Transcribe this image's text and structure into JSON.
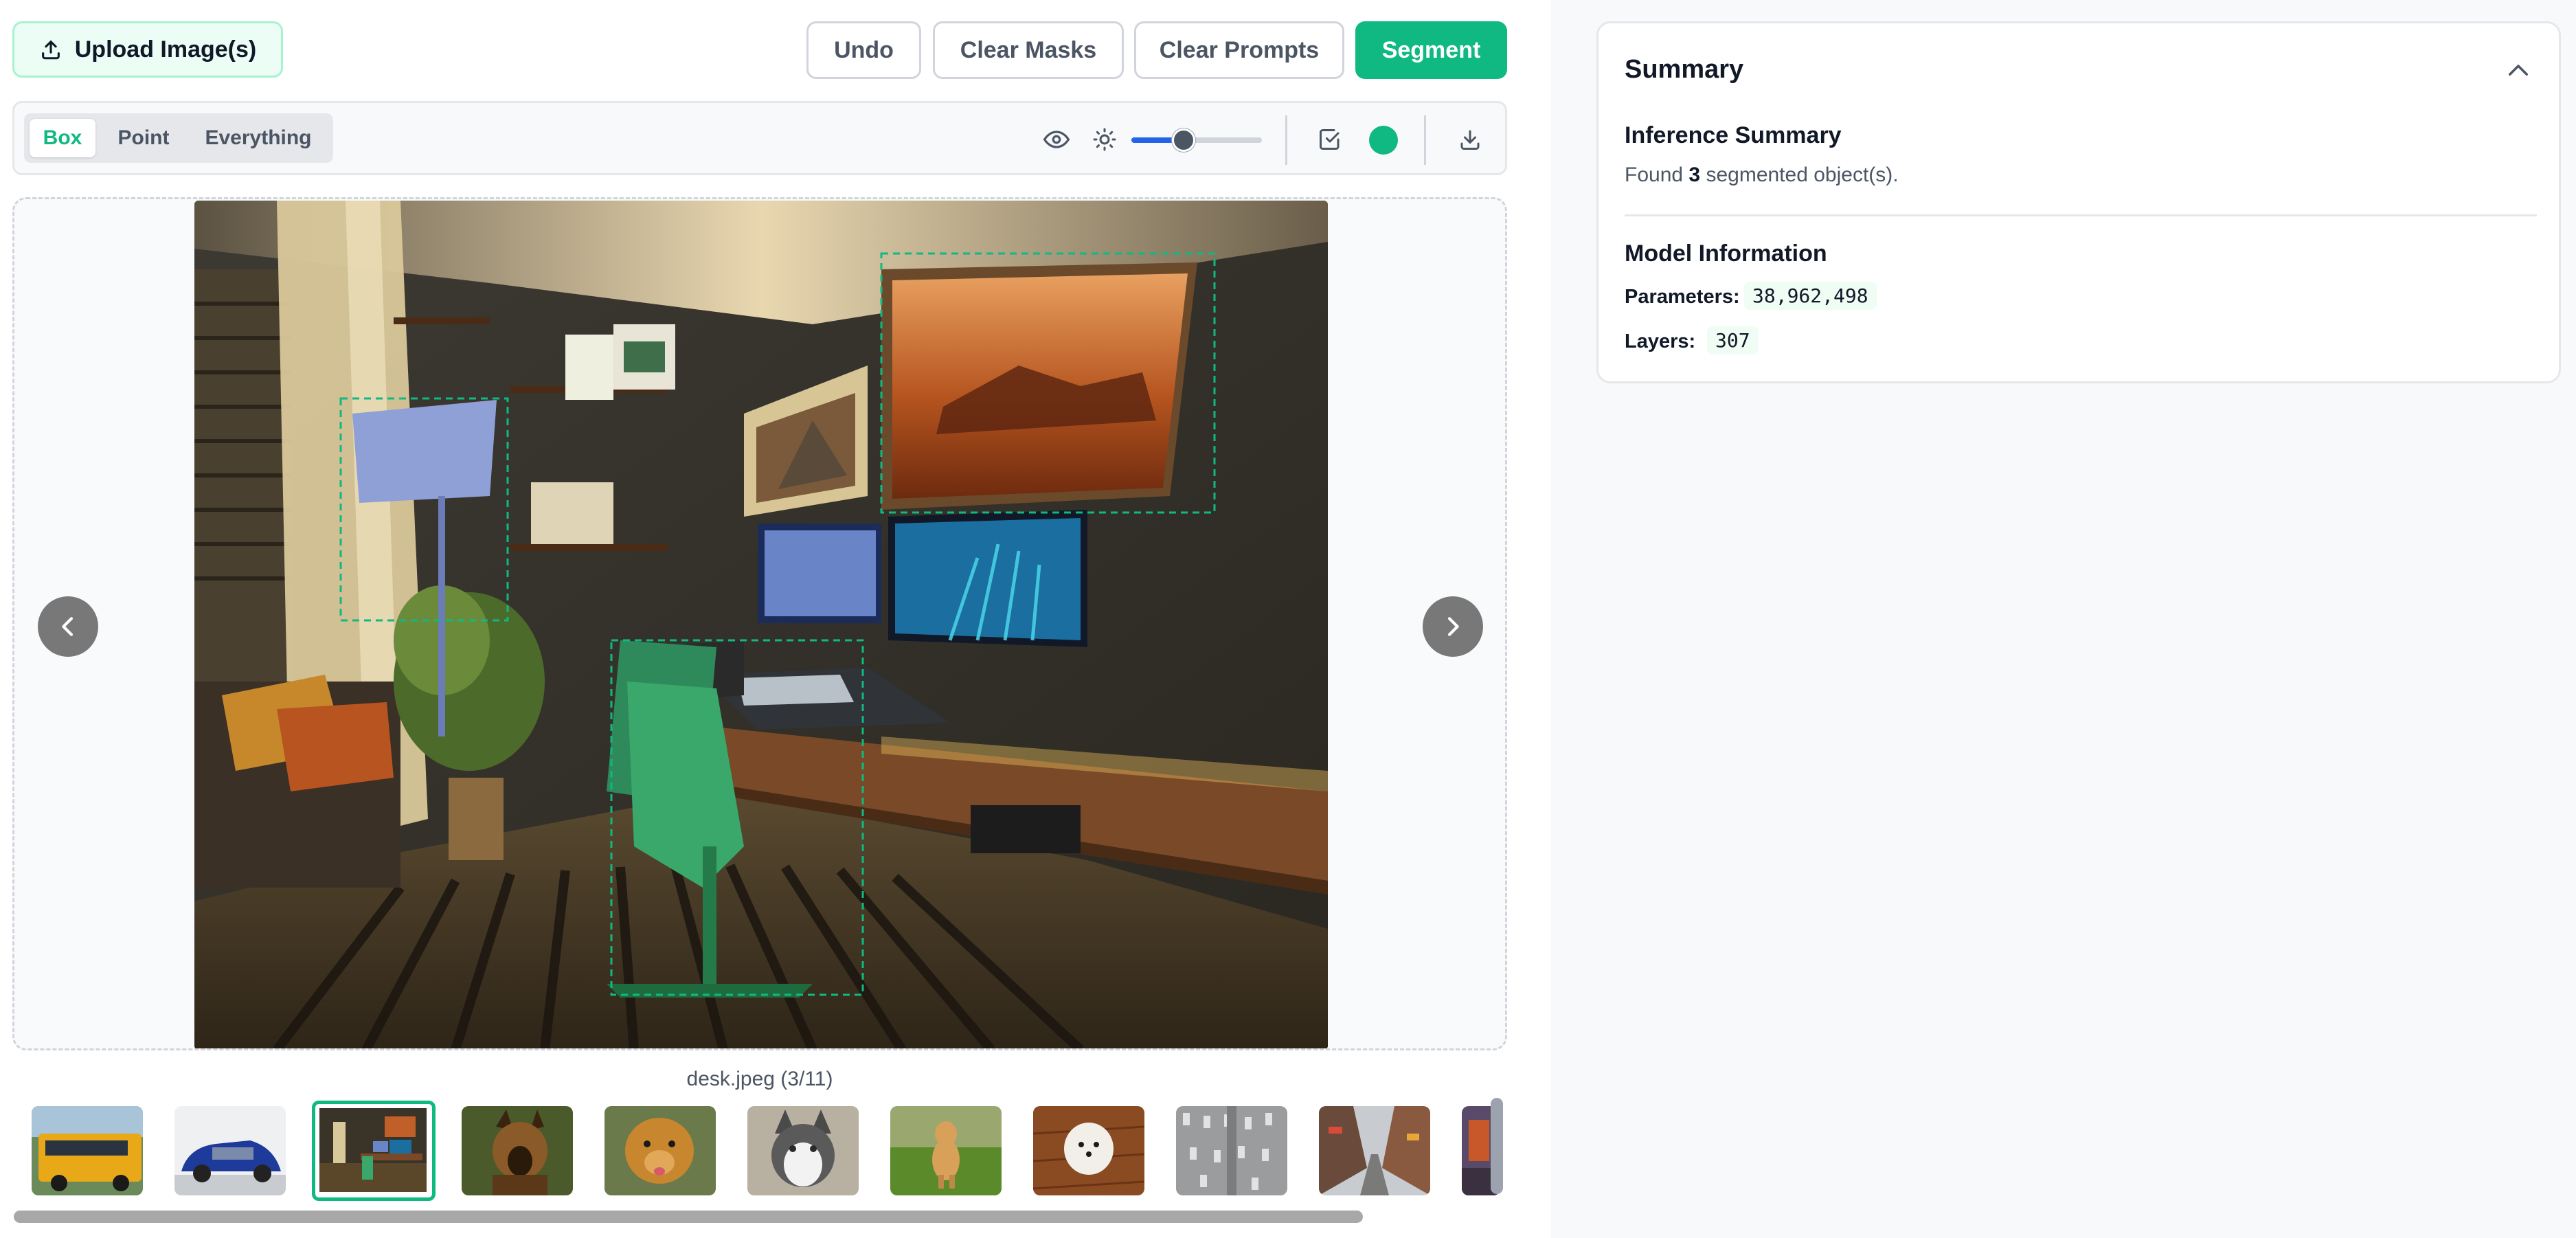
{
  "toolbar_top": {
    "upload_label": "Upload Image(s)",
    "undo_label": "Undo",
    "clear_masks_label": "Clear Masks",
    "clear_prompts_label": "Clear Prompts",
    "segment_label": "Segment"
  },
  "mode_tabs": [
    {
      "label": "Box",
      "active": true
    },
    {
      "label": "Point",
      "active": false
    },
    {
      "label": "Everything",
      "active": false
    }
  ],
  "controls": {
    "visibility_icon": "eye-icon",
    "brightness_icon": "sun-icon",
    "opacity_value": 0.4,
    "checkbox_icon": "check-square-icon",
    "mask_color": "#10b981",
    "download_icon": "download-icon"
  },
  "viewer": {
    "caption": "desk.jpeg (3/11)",
    "prev_icon": "chevron-left-icon",
    "next_icon": "chevron-right-icon"
  },
  "thumbnails": [
    {
      "name": "school-bus",
      "active": false
    },
    {
      "name": "blue-car",
      "active": false
    },
    {
      "name": "desk",
      "active": true
    },
    {
      "name": "german-shepherd",
      "active": false
    },
    {
      "name": "golden-retriever",
      "active": false
    },
    {
      "name": "husky",
      "active": false
    },
    {
      "name": "labrador-field",
      "active": false
    },
    {
      "name": "white-puppy",
      "active": false
    },
    {
      "name": "parking-lot",
      "active": false
    },
    {
      "name": "city-street",
      "active": false
    },
    {
      "name": "partial",
      "active": false
    }
  ],
  "summary": {
    "title": "Summary",
    "inference_title": "Inference Summary",
    "found_prefix": "Found",
    "found_count": "3",
    "found_suffix": "segmented object(s).",
    "model_title": "Model Information",
    "params_label": "Parameters:",
    "params_value": "38,962,498",
    "layers_label": "Layers:",
    "layers_value": "307"
  }
}
